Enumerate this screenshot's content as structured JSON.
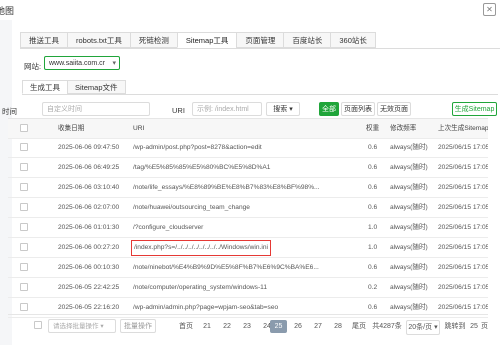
{
  "window": {
    "title": "地图"
  },
  "tabs": [
    "推送工具",
    "robots.txt工具",
    "死链检测",
    "Sitemap工具",
    "页面管理",
    "百度站长",
    "360站长"
  ],
  "active_tab": 3,
  "site": {
    "label": "网站:",
    "value": "www.saiita.com.cr"
  },
  "subtabs": [
    "生成工具",
    "Sitemap文件"
  ],
  "filters": {
    "time_label": "时间",
    "time_placeholder": "自定义时间",
    "uri_label": "URI",
    "uri_placeholder": "示例: /index.html",
    "search_btn": "搜索",
    "all_btn": "全部",
    "pages_btn": "页面列表",
    "invalid_btn": "无效页面",
    "generate_btn": "生成Sitemap"
  },
  "table": {
    "headers": [
      "收集日期",
      "URI",
      "权重",
      "修改频率",
      "上次生成Sitemap时间"
    ],
    "rows": [
      {
        "date": "2025-06-06 09:47:50",
        "uri": "/wp-admin/post.php?post=8278&action=edit",
        "weight": "0.6",
        "freq": "always(随时)",
        "last": "2025/06/15 17:05:3"
      },
      {
        "date": "2025-06-06 06:49:25",
        "uri": "/tag/%E5%85%85%E5%80%BC%E5%8D%A1",
        "weight": "0.6",
        "freq": "always(随时)",
        "last": "2025/06/15 17:05:3"
      },
      {
        "date": "2025-06-06 03:10:40",
        "uri": "/note/life_essays/%E8%89%BE%E8%B7%83%E8%BF%98%...",
        "weight": "0.6",
        "freq": "always(随时)",
        "last": "2025/06/15 17:05:3"
      },
      {
        "date": "2025-06-06 02:07:00",
        "uri": "/note/huawei/outsourcing_team_change",
        "weight": "0.6",
        "freq": "always(随时)",
        "last": "2025/06/15 17:05:3"
      },
      {
        "date": "2025-06-06 01:01:30",
        "uri": "/?configure_cloudserver",
        "weight": "1.0",
        "freq": "always(随时)",
        "last": "2025/06/15 17:05:3"
      },
      {
        "date": "2025-06-06 00:27:20",
        "uri": "/index.php?s=/../../../../../../../../Windows/win.ini",
        "weight": "1.0",
        "freq": "always(随时)",
        "last": "2025/06/15 17:05:3",
        "highlight": true
      },
      {
        "date": "2025-06-06 00:10:30",
        "uri": "/note/ninebot/%E4%B9%9D%E5%8F%B7%E6%9C%BA%E6...",
        "weight": "0.6",
        "freq": "always(随时)",
        "last": "2025/06/15 17:05:3"
      },
      {
        "date": "2025-06-05 22:42:25",
        "uri": "/note/computer/operating_system/windows-11",
        "weight": "0.2",
        "freq": "always(随时)",
        "last": "2025/06/15 17:05:3"
      },
      {
        "date": "2025-06-05 22:16:20",
        "uri": "/wp-admin/admin.php?page=wpjam-seo&tab=seo",
        "weight": "0.6",
        "freq": "always(随时)",
        "last": "2025/06/15 17:05:3"
      }
    ]
  },
  "footer": {
    "batch_placeholder": "请选择批量操作",
    "batch_btn": "批量操作",
    "first": "首页",
    "pages": [
      "21",
      "22",
      "23",
      "24",
      "25",
      "26",
      "27",
      "28"
    ],
    "active_page": "25",
    "last": "尾页",
    "total": "共4287条",
    "per_page": "20条/页",
    "jump_label": "跳转到",
    "jump_value": "25",
    "page_unit": "页"
  }
}
